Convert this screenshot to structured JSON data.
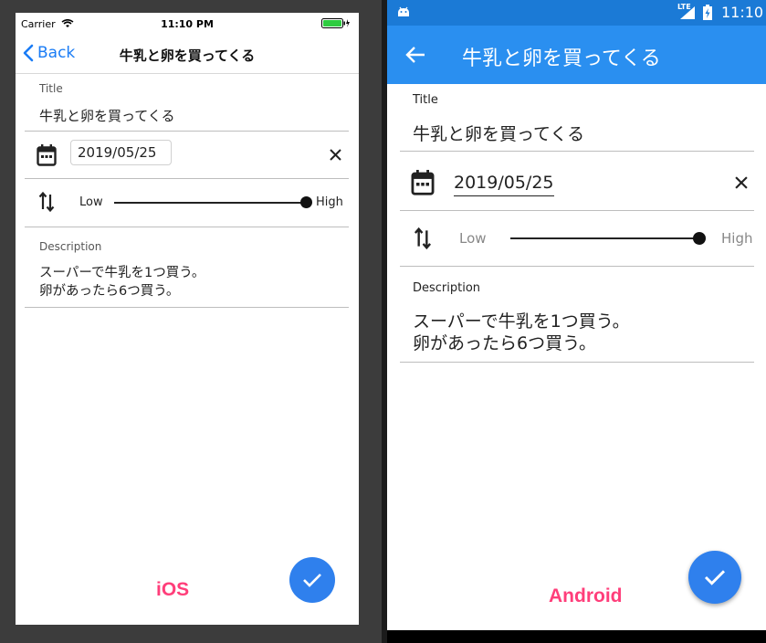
{
  "ios": {
    "status": {
      "carrier": "Carrier",
      "time": "11:10 PM"
    },
    "nav": {
      "back_label": "Back",
      "title": "牛乳と卵を買ってくる"
    },
    "title_label": "Title",
    "title_value": "牛乳と卵を買ってくる",
    "date_value": "2019/05/25",
    "priority": {
      "low": "Low",
      "high": "High",
      "level": 1.0
    },
    "description_label": "Description",
    "description_lines": [
      "スーパーで牛乳を1つ買う。",
      "卵があったら6つ買う。"
    ],
    "caption": "iOS"
  },
  "android": {
    "status": {
      "network": "LTE",
      "time": "11:10"
    },
    "appbar_title": "牛乳と卵を買ってくる",
    "title_label": "Title",
    "title_value": "牛乳と卵を買ってくる",
    "date_value": "2019/05/25",
    "priority": {
      "low": "Low",
      "high": "High",
      "level": 1.0
    },
    "description_label": "Description",
    "description_lines": [
      "スーパーで牛乳を1つ買う。",
      "卵があったら6つ買う。"
    ],
    "caption": "Android"
  },
  "colors": {
    "ios_accent": "#1a7cf5",
    "android_appbar": "#2a8ff0",
    "android_statusbar": "#1b7ad6",
    "fab": "#2f80ed",
    "caption": "#ff3e7a"
  },
  "icons": [
    "back-chevron-icon",
    "calendar-icon",
    "close-icon",
    "sort-arrows-icon",
    "check-icon",
    "wifi-icon",
    "battery-icon",
    "signal-icon",
    "android-robot-icon",
    "back-arrow-icon"
  ]
}
